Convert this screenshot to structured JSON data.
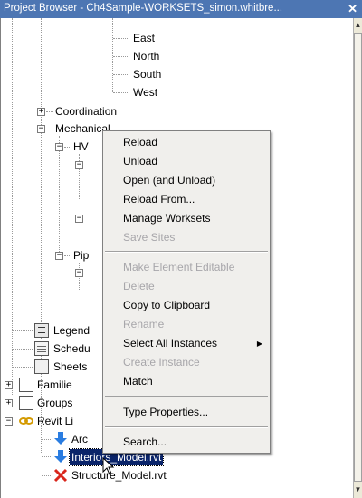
{
  "window": {
    "title": "Project Browser - Ch4Sample-WORKSETS_simon.whitbre...",
    "close_glyph": "✕"
  },
  "tree": {
    "elevations": [
      "East",
      "North",
      "South",
      "West"
    ],
    "coordination": "Coordination",
    "mechanical": "Mechanical",
    "hvac_partial": "HV",
    "piping_partial": "Pip",
    "legends": "Legend",
    "schedules": "Schedu",
    "sheets": "Sheets",
    "families": "Familie",
    "groups": "Groups",
    "revit_links": "Revit Li",
    "links": [
      "Arc",
      "Interiors_Model.rvt",
      "Structure_Model.rvt"
    ]
  },
  "context_menu": {
    "items": [
      {
        "label": "Reload",
        "enabled": true
      },
      {
        "label": "Unload",
        "enabled": true
      },
      {
        "label": "Open (and Unload)",
        "enabled": true
      },
      {
        "label": "Reload From...",
        "enabled": true
      },
      {
        "label": "Manage Worksets",
        "enabled": true
      },
      {
        "label": "Save Sites",
        "enabled": false
      },
      {
        "label": "Make Element Editable",
        "enabled": false
      },
      {
        "label": "Delete",
        "enabled": false
      },
      {
        "label": "Copy to Clipboard",
        "enabled": true
      },
      {
        "label": "Rename",
        "enabled": false
      },
      {
        "label": "Select All Instances",
        "enabled": true
      },
      {
        "label": "Create Instance",
        "enabled": false
      },
      {
        "label": "Match",
        "enabled": true
      },
      {
        "label": "Type Properties...",
        "enabled": true
      },
      {
        "label": "Search...",
        "enabled": true
      }
    ]
  },
  "colors": {
    "title_bar": "#4d76b3",
    "selection": "#0a246a",
    "link_arrow": "#2a7de1",
    "link_error": "#d9261c"
  }
}
